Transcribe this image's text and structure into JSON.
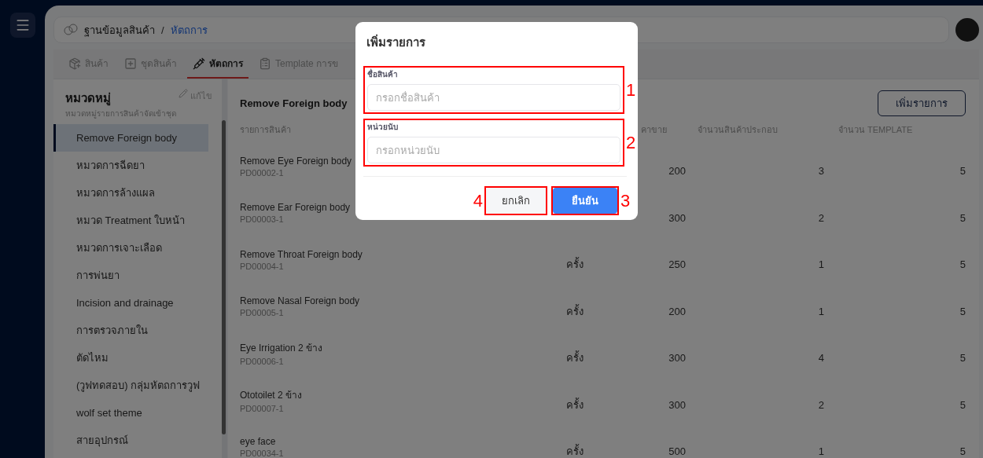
{
  "breadcrumb_separator": "/",
  "breadcrumb": [
    {
      "label": "ฐานข้อมูลสินค้า",
      "selected": false
    },
    {
      "label": "หัตถการ",
      "selected": true
    }
  ],
  "tabs": [
    {
      "label": "สินค้า",
      "selected": false,
      "kind": "product"
    },
    {
      "label": "ชุดสินค้า",
      "selected": false,
      "kind": "set"
    },
    {
      "label": "หัตถการ",
      "selected": true,
      "kind": "procedure"
    },
    {
      "label": "Template การข",
      "selected": false,
      "kind": "template"
    }
  ],
  "categories": {
    "title": "หมวดหมู่",
    "subtitle": "หมวดหมู่รายการสินค้าจัดเข้าชุด",
    "edit_label": "แก้ไข",
    "items": [
      {
        "label": "Remove Foreign body",
        "selected": true
      },
      {
        "label": "หมวดการฉีดยา",
        "selected": false
      },
      {
        "label": "หมวดการล้างแผล",
        "selected": false
      },
      {
        "label": "หมวด Treatment ใบหน้า",
        "selected": false
      },
      {
        "label": "หมวดการเจาะเลือด",
        "selected": false
      },
      {
        "label": "การพ่นยา",
        "selected": false
      },
      {
        "label": "Incision and drainage",
        "selected": false
      },
      {
        "label": "การตรวจภายใน",
        "selected": false
      },
      {
        "label": "ตัดไหม",
        "selected": false
      },
      {
        "label": "(วูฟทดสอบ) กลุ่มหัตถการวูฟ",
        "selected": false
      },
      {
        "label": "wolf set theme",
        "selected": false
      },
      {
        "label": "สายอุปกรณ์",
        "selected": false
      }
    ]
  },
  "content": {
    "title": "Remove Foreign body",
    "add_button": "เพิ่มรายการ",
    "columns": [
      "รายการสินค้า",
      "",
      "คาขาย",
      "จำนวนสินค้าประกอบ",
      "จำนวน TEMPLATE"
    ],
    "rows": [
      {
        "name": "Remove Eye Foreign body",
        "code": "PD00002-1",
        "price": "200",
        "items": "3",
        "templates": "5"
      },
      {
        "name": "Remove Ear Foreign body",
        "code": "PD00003-1",
        "price": "300",
        "items": "2",
        "templates": "5"
      },
      {
        "name": "Remove Throat Foreign body",
        "code": "PD00004-1",
        "unit": "ครั้ง",
        "price": "250",
        "items": "1",
        "templates": "5"
      },
      {
        "name": "Remove Nasal Foreign body",
        "code": "PD00005-1",
        "unit": "ครั้ง",
        "price": "200",
        "items": "1",
        "templates": "5"
      },
      {
        "name": "Eye Irrigation 2 ข้าง",
        "code": "PD00006-1",
        "unit": "ครั้ง",
        "price": "300",
        "items": "4",
        "templates": "5"
      },
      {
        "name": "Ototoilet 2 ข้าง",
        "code": "PD00007-1",
        "unit": "ครั้ง",
        "price": "300",
        "items": "2",
        "templates": "5"
      },
      {
        "name": "eye face",
        "code": "PD00034-1",
        "unit": "ครั้ง",
        "price": "500",
        "items": "1",
        "templates": "5"
      }
    ]
  },
  "modal": {
    "title": "เพิ่มรายการ",
    "fields": [
      {
        "label": "ชื่อสินค้า",
        "placeholder": "กรอกชื่อสินค้า",
        "marker": "1"
      },
      {
        "label": "หน่วยนับ",
        "placeholder": "กรอกหน่วยนับ",
        "marker": "2"
      }
    ],
    "buttons": [
      {
        "label": "ยกเลิก",
        "kind": "secondary",
        "marker": "4"
      },
      {
        "label": "ยืนยัน",
        "kind": "primary",
        "marker": "3"
      }
    ]
  }
}
